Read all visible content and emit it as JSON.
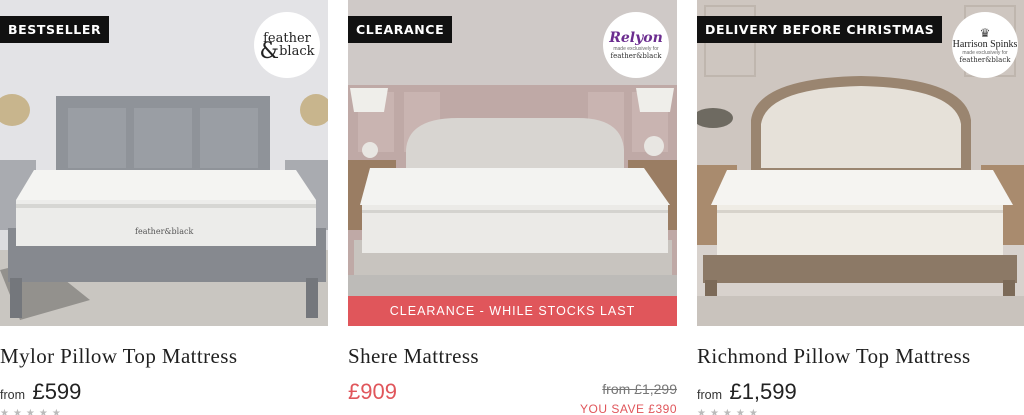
{
  "products": [
    {
      "badge": "BESTSELLER",
      "logo": {
        "line1": "feather",
        "amp": "&",
        "line2": "black"
      },
      "title": "Mylor Pillow Top Mattress",
      "from_label": "from",
      "price": "£599",
      "rating_stars": "★★★★★"
    },
    {
      "badge": "CLEARANCE",
      "logo": {
        "brand": "Relyon",
        "small": "made exclusively for",
        "fb": "feather&black"
      },
      "strip": "CLEARANCE - WHILE STOCKS LAST",
      "title": "Shere Mattress",
      "price": "£909",
      "was_price": "from £1,299",
      "save": "YOU SAVE £390"
    },
    {
      "badge": "DELIVERY BEFORE CHRISTMAS",
      "logo": {
        "crest": "♛",
        "brand": "Harrison Spinks",
        "small": "made exclusively for",
        "fb": "feather&black"
      },
      "title": "Richmond Pillow Top Mattress",
      "from_label": "from",
      "price": "£1,599",
      "rating_stars": "★★★★★"
    }
  ],
  "colors": {
    "sale": "#e0565b",
    "badge_bg": "#111111",
    "relyon": "#6b2c8f"
  }
}
